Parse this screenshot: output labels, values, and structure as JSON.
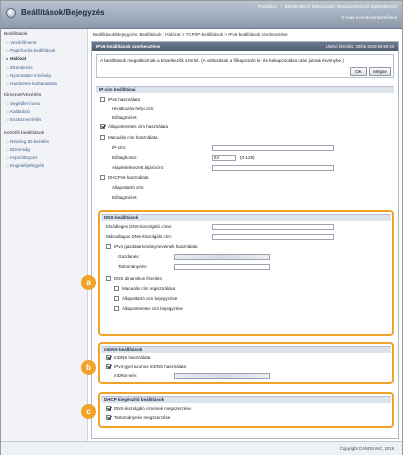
{
  "header": {
    "app_title": "Beállítások/Bejegyzés",
    "portal_link": "Portálhoz",
    "logout_link": "Bejelentkező felhasználó: Rendszerkezelő Kijelentkezés",
    "email_link": "E-mail a rendszerkezelőnek"
  },
  "sidebar": {
    "settings_head": "Beállítások",
    "settings_items": [
      "Vezérlőmenü",
      "Papírforrás-beállítások",
      "Hálózat",
      "Elrendezés",
      "Nyomtatási minőség",
      "Hardveres karbantartás"
    ],
    "active_index": 2,
    "adjust_head": "Kimenet/Vezérlés",
    "adjust_items": [
      "Segédlet mono",
      "Kalibráció",
      "Eszközvezérlés"
    ],
    "manage_head": "Kezelői beállítások",
    "manage_items": [
      "Részleg ID-kezelés",
      "Biztonság",
      "Import/Export",
      "Engedélyt/Egyéb"
    ]
  },
  "breadcrumb": "Beállítások/Bejegyzés: Beállítások : Hálózat > TCP/IP-beállítások > IPv6-beállítások szerkesztése",
  "panel": {
    "title": "IPv6-beállítások szerkesztése",
    "last_update": "Utolsó frissítés: 20/06 2019 09:59:10",
    "notice": "A beállítások megváltoznak a következők szerint. (A változások a főkapcsoló ki- és bekapcsolása után jutnak érvénybe.)",
    "ok_label": "OK",
    "cancel_label": "Mégse"
  },
  "ip_section": {
    "head": "IP-cím beállításai",
    "use_ipv6": "IPv6 használata",
    "link_local_label": "Hivatkozás-helyi cím:",
    "prefix_len_label": "Előtagméret:",
    "stateless": "Állapotmentes cím használata",
    "manual_addr": "Manuális cím használata",
    "ip_addr_label": "IP-cím:",
    "prefix_label": "Előtaghossz:",
    "prefix_value": "64",
    "prefix_range": "(0-128)",
    "gateway_label": "Alapértelmezett átjárócím:",
    "dhcp": "DHCPv6 használata",
    "state_addr_label": "Állapottartó cím:",
    "state_prefix_label": "Előtagméret:"
  },
  "dns_section": {
    "head": "DNS-beállítások",
    "primary_label": "Elsődleges DNS-kiszolgáló címe:",
    "secondary_label": "Másodlagos DNS-kiszolgáló cím:",
    "same_host": "IPv4 gazdatartományneveinek használata",
    "host_name_label": "Gazdanév:",
    "domain_name_label": "Tartománynév:",
    "dyn_update": "DNS dinamikus frissítés",
    "register_manual": "Manuális cím regisztrálása",
    "register_stateful": "Állapottartó cím bejegyzése",
    "register_stateless": "Állapotmentes cím bejegyzése"
  },
  "mdns_section": {
    "head": "mDNS-beállítások",
    "use_mdns": "mDNS használata",
    "same_as_ipv4": "IPv4-gyel azonos mDNS használata",
    "mdns_name_label": "mDNS-név:"
  },
  "dhcp_section": {
    "head": "DHCP kiegészítő beállítások",
    "request_dns": "DNS-kiszolgáló címének megszerzése",
    "request_domain": "Tartománynév megszerzése"
  },
  "markers": {
    "a": "a",
    "b": "b",
    "c": "c"
  },
  "footer": {
    "copyright": "Copyright CANON INC. 2019"
  },
  "colors": {
    "marker": "#f0a22a",
    "header_bar": "#8d9aab",
    "panel_head": "#4f5d70"
  }
}
